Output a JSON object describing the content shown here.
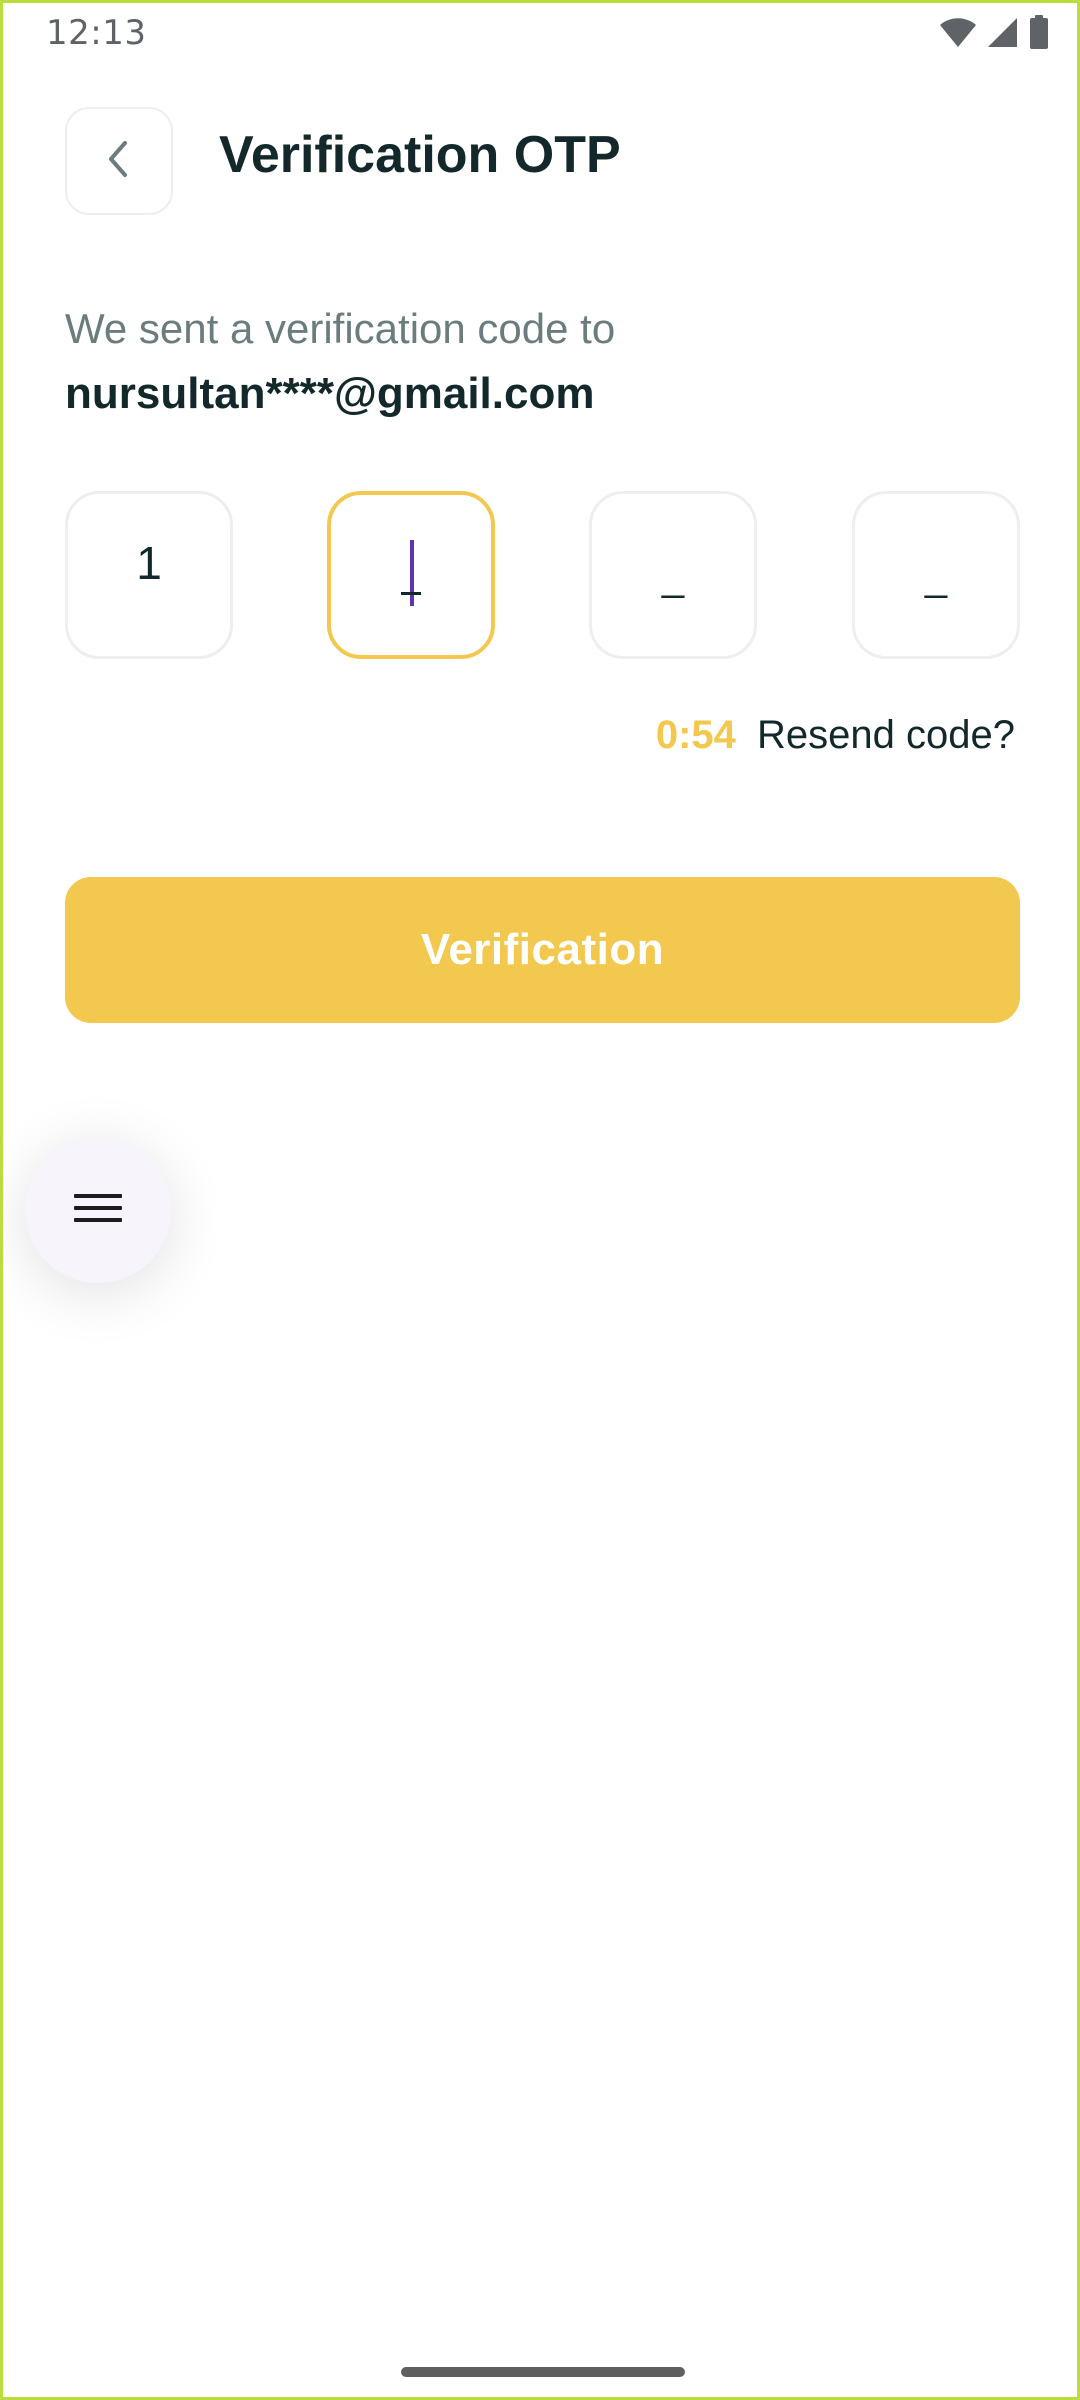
{
  "status_bar": {
    "time": "12:13",
    "icons": [
      "wifi-icon",
      "cellular-signal-icon",
      "battery-icon"
    ]
  },
  "header": {
    "back_icon": "chevron-left-icon",
    "title": "Verification OTP"
  },
  "message": {
    "line1": "We sent a verification code to",
    "email": "nursultan****@gmail.com"
  },
  "otp": {
    "boxes": [
      {
        "value": "1",
        "state": "filled"
      },
      {
        "value": "",
        "state": "focused"
      },
      {
        "value": "_",
        "state": "empty"
      },
      {
        "value": "_",
        "state": "empty"
      }
    ],
    "placeholder": "_"
  },
  "resend": {
    "timer": "0:54",
    "label": "Resend code?"
  },
  "actions": {
    "verify_label": "Verification"
  },
  "fab": {
    "icon": "hamburger-menu-icon"
  },
  "colors": {
    "accent": "#f2c84f",
    "title_text": "#13282a",
    "muted_text": "#6b7c7e",
    "cursor": "#5e35b1",
    "frame_border": "#b9dd3c"
  }
}
